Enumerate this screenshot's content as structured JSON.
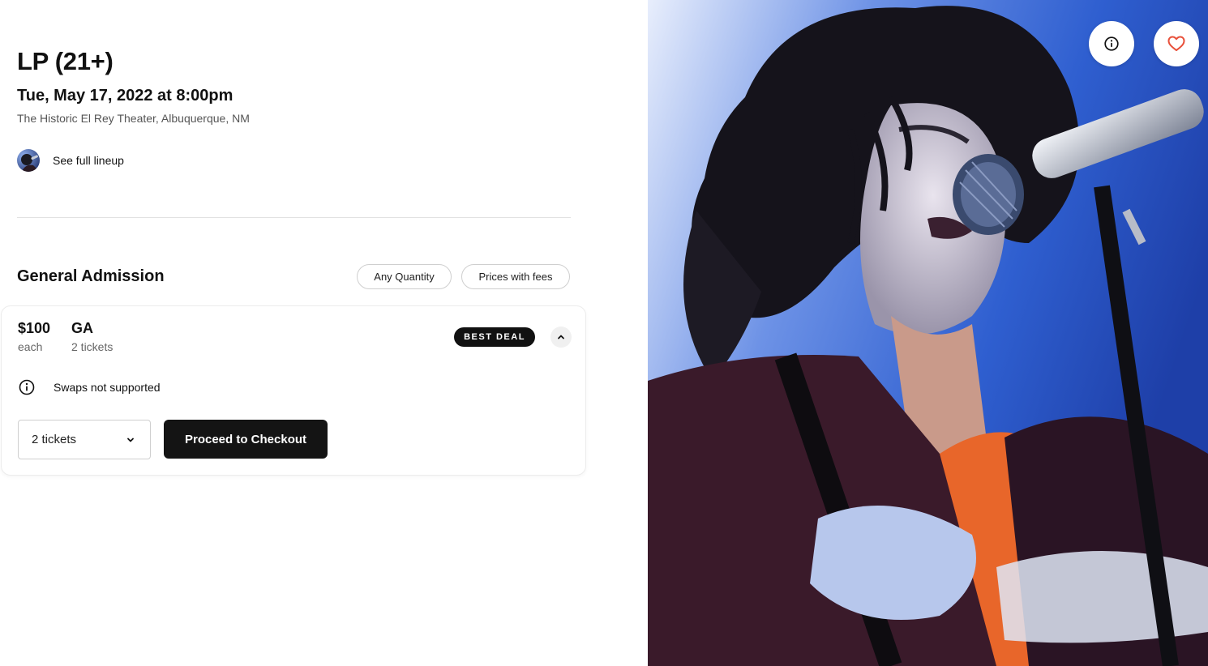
{
  "event": {
    "title": "LP (21+)",
    "date": "Tue, May 17, 2022 at 8:00pm",
    "venue": "The Historic El Rey Theater, Albuquerque, NM"
  },
  "lineup": {
    "label": "See full lineup"
  },
  "listings": {
    "section_title": "General Admission",
    "filters": {
      "quantity": "Any Quantity",
      "fees": "Prices with fees"
    },
    "card": {
      "price": "$100",
      "price_sub": "each",
      "section": "GA",
      "section_sub": "2 tickets",
      "badge": "BEST DEAL",
      "notice": "Swaps not supported",
      "quantity_selected": "2 tickets",
      "checkout_label": "Proceed to Checkout"
    }
  },
  "icons": {
    "info": "info-icon",
    "favorite": "heart-icon",
    "collapse": "chevron-up-icon",
    "dropdown": "chevron-down-icon"
  },
  "colors": {
    "primary_button": "#141414",
    "badge_bg": "#111111",
    "heart": "#e8503a",
    "stage_light": "#3f6fd8"
  }
}
